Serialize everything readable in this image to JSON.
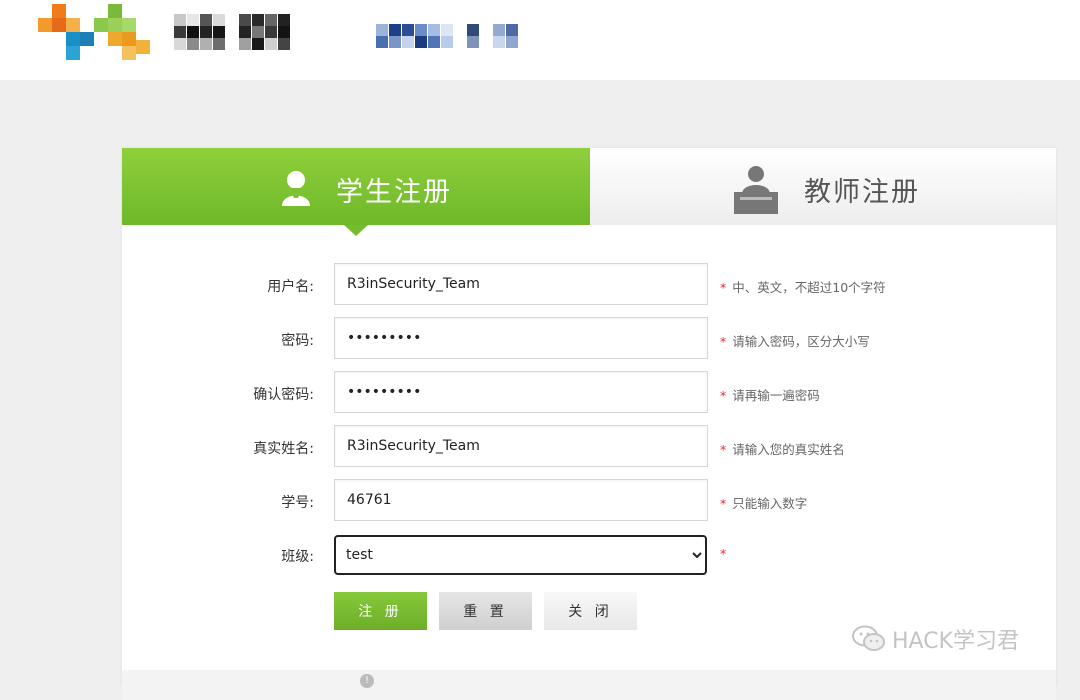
{
  "tabs": {
    "student": "学生注册",
    "teacher": "教师注册"
  },
  "form": {
    "username": {
      "label": "用户名:",
      "value": "R3inSecurity_Team",
      "hint": "中、英文，不超过10个字符"
    },
    "password": {
      "label": "密码:",
      "value": "•••••••••",
      "hint": "请输入密码，区分大小写"
    },
    "confirm_password": {
      "label": "确认密码:",
      "value": "•••••••••",
      "hint": "请再输一遍密码"
    },
    "real_name": {
      "label": "真实姓名:",
      "value": "R3inSecurity_Team",
      "hint": "请输入您的真实姓名"
    },
    "student_id": {
      "label": "学号:",
      "value": "46761",
      "hint": "只能输入数字"
    },
    "class": {
      "label": "班级:",
      "selected": "test"
    },
    "required_mark": "*"
  },
  "buttons": {
    "register": "注 册",
    "reset": "重 置",
    "close": "关 闭"
  },
  "watermark": {
    "text": "HACK学习君",
    "icon": "wechat-icon"
  },
  "colors": {
    "accent_green": "#7cc133",
    "required_red": "#e22233"
  }
}
